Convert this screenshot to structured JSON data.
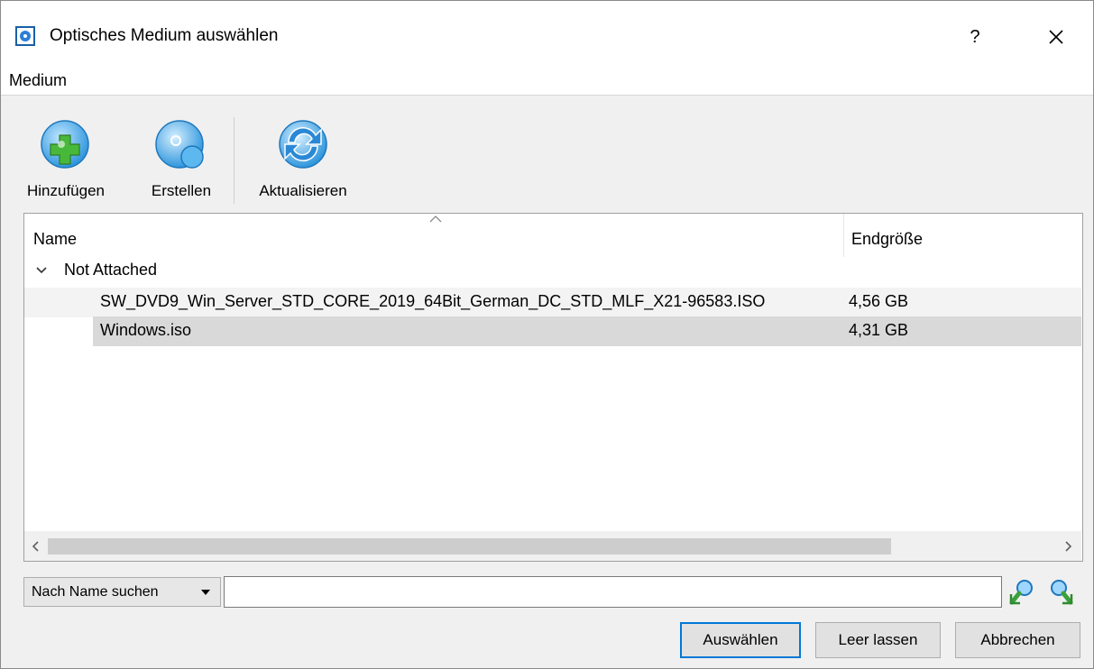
{
  "window": {
    "title": "Optisches Medium auswählen",
    "help_label": "?"
  },
  "menubar": {
    "items": [
      {
        "label": "Medium"
      }
    ]
  },
  "toolbar": {
    "items": [
      {
        "label": "Hinzufügen",
        "icon": "add-disc-icon"
      },
      {
        "label": "Erstellen",
        "icon": "create-disc-icon"
      },
      {
        "label": "Aktualisieren",
        "icon": "refresh-icon"
      }
    ]
  },
  "list": {
    "columns": [
      "Name",
      "Endgröße"
    ],
    "groups": [
      {
        "label": "Not Attached",
        "items": [
          {
            "name": "SW_DVD9_Win_Server_STD_CORE_2019_64Bit_German_DC_STD_MLF_X21-96583.ISO",
            "size": "4,56 GB"
          },
          {
            "name": "Windows.iso",
            "size": "4,31 GB",
            "selected": true
          }
        ]
      }
    ]
  },
  "search": {
    "mode": "Nach Name suchen",
    "value": ""
  },
  "buttons": {
    "select": "Auswählen",
    "leave_empty": "Leer lassen",
    "cancel": "Abbrechen"
  },
  "colors": {
    "accent": "#0078d7",
    "icon_blue": "#3aa3e3",
    "icon_green": "#4fbf3a",
    "selection": "#d9d9d9"
  }
}
